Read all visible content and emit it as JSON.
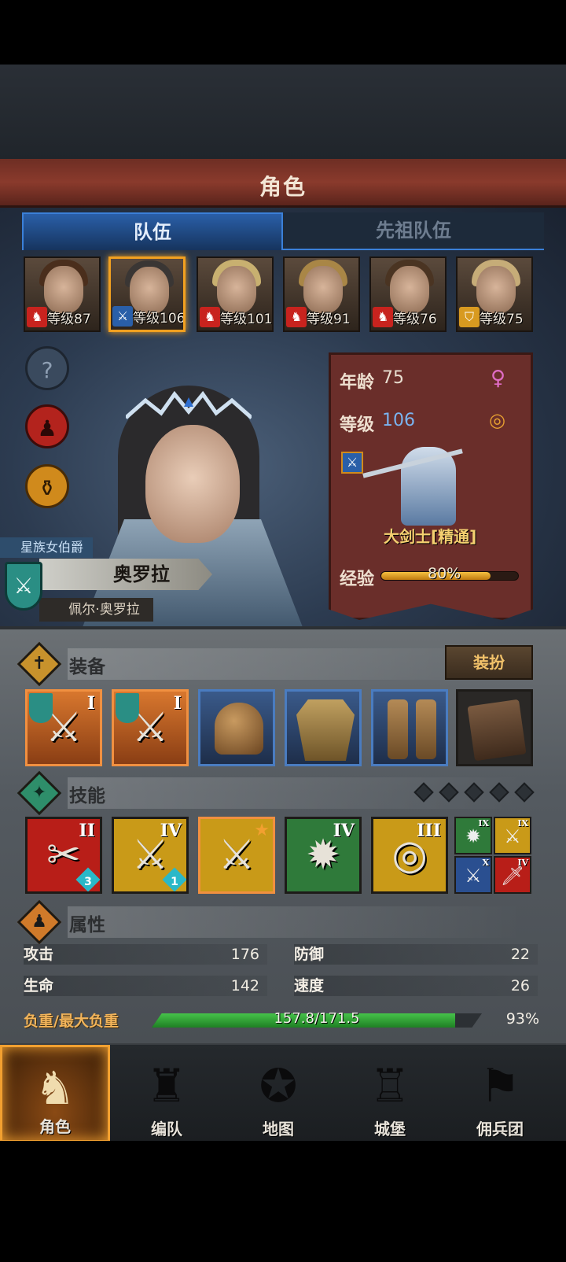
{
  "header": {
    "title": "角色"
  },
  "tabs": [
    {
      "label": "队伍",
      "active": true
    },
    {
      "label": "先祖队伍",
      "active": false
    }
  ],
  "party": [
    {
      "level_text": "等级87",
      "badge_icon": "horse-icon",
      "badge_color": "#c8231e",
      "selected": false
    },
    {
      "level_text": "等级106",
      "badge_icon": "sword-icon",
      "badge_color": "#2a5fa8",
      "selected": true
    },
    {
      "level_text": "等级101",
      "badge_icon": "horse-icon",
      "badge_color": "#c8231e",
      "selected": false
    },
    {
      "level_text": "等级91",
      "badge_icon": "horse-icon",
      "badge_color": "#c8231e",
      "selected": false
    },
    {
      "level_text": "等级76",
      "badge_icon": "horse-icon",
      "badge_color": "#c8231e",
      "selected": false
    },
    {
      "level_text": "等级75",
      "badge_icon": "shield-icon",
      "badge_color": "#d89a20",
      "selected": false
    }
  ],
  "side_buttons": [
    {
      "icon": "help-icon",
      "glyph": "?"
    },
    {
      "icon": "person-icon",
      "glyph": "♟"
    },
    {
      "icon": "potion-icon",
      "glyph": "⚱"
    }
  ],
  "character": {
    "title": "星族女伯爵",
    "name": "奥罗拉",
    "full_name": "佩尔·奥罗拉"
  },
  "stats_card": {
    "age_label": "年龄",
    "age_value": "75",
    "gender_icon": "female-icon",
    "level_label": "等级",
    "level_value": "106",
    "ring_icon": "ring-icon",
    "class_name": "大剑士[精通]",
    "exp_label": "经验",
    "exp_percent_text": "80%",
    "exp_fraction": 0.8
  },
  "equipment": {
    "title": "装备",
    "dress_button": "装扮",
    "items": [
      {
        "icon": "greatsword-icon",
        "glyph": "⚔",
        "tier": "I",
        "frame": "orange"
      },
      {
        "icon": "greatsword-icon",
        "glyph": "⚔",
        "tier": "I",
        "frame": "orange"
      },
      {
        "icon": "helmet-icon",
        "glyph": "⛑",
        "tier": "",
        "frame": "blue"
      },
      {
        "icon": "chest-armor-icon",
        "glyph": "🛡",
        "tier": "",
        "frame": "blue"
      },
      {
        "icon": "boots-icon",
        "glyph": "👢",
        "tier": "",
        "frame": "blue"
      },
      {
        "icon": "book-icon",
        "glyph": "📕",
        "tier": "",
        "frame": "dark"
      }
    ]
  },
  "skills": {
    "title": "技能",
    "items": [
      {
        "icon": "slash-skill-icon",
        "glyph": "✂",
        "tier": "II",
        "count": "3",
        "bg": "#b81e18"
      },
      {
        "icon": "blade-skill-icon",
        "glyph": "⚔",
        "tier": "IV",
        "count": "1",
        "bg": "#c99a18"
      },
      {
        "icon": "sword-aura-skill-icon",
        "glyph": "⚔",
        "tier": "",
        "count": "",
        "bg": "#c99a18"
      },
      {
        "icon": "burst-skill-icon",
        "glyph": "✹",
        "tier": "IV",
        "count": "",
        "bg": "#2f7a3a"
      },
      {
        "icon": "target-skill-icon",
        "glyph": "◎",
        "tier": "III",
        "count": "",
        "bg": "#c99a18"
      }
    ],
    "small_items": [
      {
        "icon": "burst-skill-icon",
        "glyph": "✹",
        "tier": "IX",
        "bg": "#2f7a3a"
      },
      {
        "icon": "blade-skill-icon",
        "glyph": "⚔",
        "tier": "IX",
        "bg": "#c99a18"
      },
      {
        "icon": "sword-skill-icon",
        "glyph": "⚔",
        "tier": "X",
        "bg": "#2a4f90"
      },
      {
        "icon": "sword-skill-icon",
        "glyph": "🗡",
        "tier": "IV",
        "bg": "#b81e18"
      }
    ]
  },
  "attributes": {
    "title": "属性",
    "rows": [
      {
        "name": "攻击",
        "value": "176",
        "name2": "防御",
        "value2": "22"
      },
      {
        "name": "生命",
        "value": "142",
        "name2": "速度",
        "value2": "26"
      }
    ],
    "load_label": "负重/最大负重",
    "load_text": "157.8/171.5",
    "load_percent_text": "93%",
    "load_fraction": 0.92
  },
  "nav": [
    {
      "label": "角色",
      "icon": "knight-icon",
      "glyph": "♞",
      "active": true
    },
    {
      "label": "编队",
      "icon": "helmet-crest-icon",
      "glyph": "♜",
      "active": false
    },
    {
      "label": "地图",
      "icon": "compass-map-icon",
      "glyph": "✪",
      "active": false
    },
    {
      "label": "城堡",
      "icon": "castle-icon",
      "glyph": "♖",
      "active": false
    },
    {
      "label": "佣兵团",
      "icon": "mercenary-icon",
      "glyph": "⚑",
      "active": false
    }
  ],
  "colors": {
    "accent_orange": "#f1a020",
    "tab_blue": "#3b80d8",
    "exp_gold": "#f5c040",
    "load_green": "#46c24a"
  }
}
